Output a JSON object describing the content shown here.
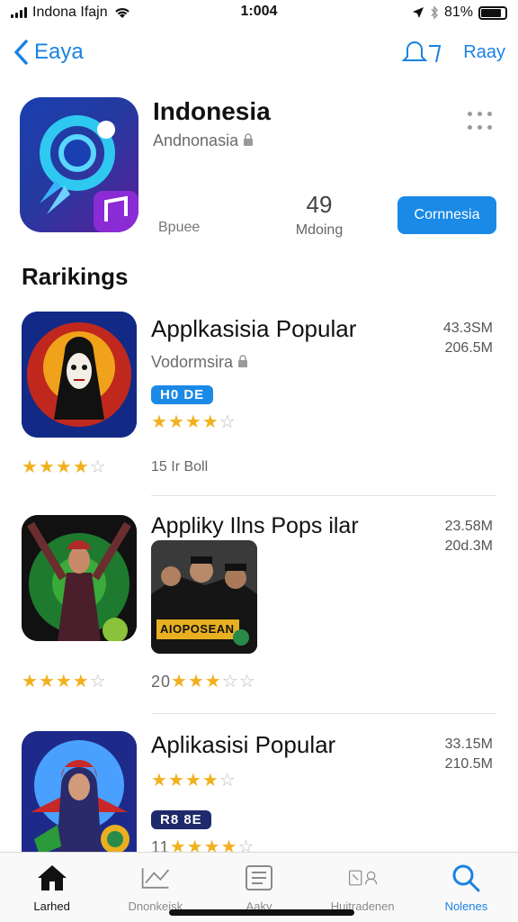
{
  "status_bar": {
    "carrier": "Indona Ifajn",
    "time": "1:004",
    "battery_percent": "81%",
    "battery_level": 0.85
  },
  "nav": {
    "back_label": "Eaya",
    "right_label": "Raay"
  },
  "app": {
    "title": "Indonesia",
    "subtitle": "Andnonasia",
    "stat_left": "Bpuee",
    "rating_value": "49",
    "rating_label": "Mdoing",
    "get_button": "Cornnesia"
  },
  "section": {
    "title": "Rarikings"
  },
  "items": [
    {
      "title": "Applkasisia Popular",
      "subtitle": "Vodormsira",
      "badge": "H0 DE",
      "meta1": "43.3SM",
      "meta2": "206.5M",
      "stars_row1_count": 4,
      "stars_row2_count": 4,
      "caption": "15 Ir Boll"
    },
    {
      "title": "Appliky Ilns Pops ilar",
      "meta1": "23.58M",
      "meta2": "20d.3M",
      "poster_label": "AIOPOSEAN",
      "stars_left_count": 4,
      "stars_right_prefix": "20",
      "stars_right_count": 3
    },
    {
      "title": "Aplikasisi Popular",
      "meta1": "33.15M",
      "meta2": "210.5M",
      "badge": "R8 8E",
      "stars_count": 4,
      "caption_prefix": "11"
    }
  ],
  "tabs": [
    {
      "label": "Larhed",
      "icon": "home-icon"
    },
    {
      "label": "Dnonkeisk",
      "icon": "chart-icon"
    },
    {
      "label": "Aaky",
      "icon": "list-icon"
    },
    {
      "label": "Huitradenen",
      "icon": "apps-icon"
    },
    {
      "label": "Nolenes",
      "icon": "search-icon"
    }
  ],
  "colors": {
    "accent": "#1a82e2",
    "star": "#f2b01e",
    "badge_bg": "#1a8ae6",
    "badge_dark": "#1e2a6b"
  }
}
